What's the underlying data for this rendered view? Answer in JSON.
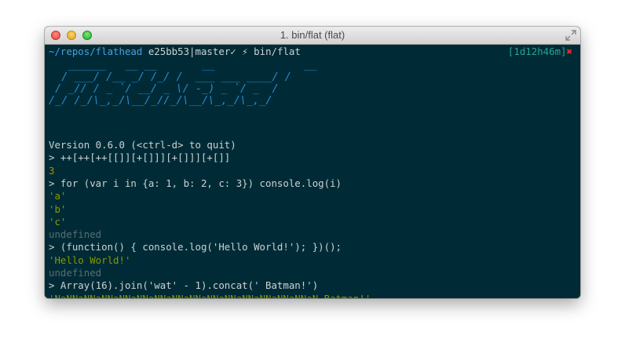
{
  "window": {
    "title": "1. bin/flat (flat)"
  },
  "prompt": {
    "path": "~/repos/flathead",
    "hash": "e25bb53",
    "separator": "|",
    "branch": "master",
    "check": "✓",
    "bolt": "⚡",
    "command": "bin/flat",
    "timer": "[1d12h46m]",
    "timer_mark": "✖"
  },
  "banner": {
    "ascii": "   ______   __ __       __              __\n  / ___/ /__ _/ /_/ /  ___ ___ ____/ /\n / _// / _ `/ __/ _ \\/ -_) _ `/ _  / \n/_/ /_/\\_,_/\\__/_//_/\\__/\\_,_/\\_,_/  "
  },
  "lines": [
    {
      "text": "Version 0.6.0 (<ctrl-d> to quit)",
      "kind": "plain"
    },
    {
      "text": "> ++[++[++[[]][+[]]][+[]]][+[]]",
      "kind": "plain"
    },
    {
      "text": "3",
      "kind": "yellow"
    },
    {
      "text": "> for (var i in {a: 1, b: 2, c: 3}) console.log(i)",
      "kind": "plain"
    },
    {
      "text": "'a'",
      "kind": "green"
    },
    {
      "text": "'b'",
      "kind": "green"
    },
    {
      "text": "'c'",
      "kind": "green"
    },
    {
      "text": "undefined",
      "kind": "grey"
    },
    {
      "text": "> (function() { console.log('Hello World!'); })();",
      "kind": "plain"
    },
    {
      "text": "'Hello World!'",
      "kind": "green"
    },
    {
      "text": "undefined",
      "kind": "grey"
    },
    {
      "text": "> Array(16).join('wat' - 1).concat(' Batman!')",
      "kind": "plain"
    },
    {
      "text": "'NaNNaNNaNNaNNaNNaNNaNNaNNaNNaNNaNNaNNaNNaNNaN Batman!'",
      "kind": "green"
    }
  ],
  "input_prompt": ">",
  "colors": {
    "terminal_bg": "#002b36",
    "path_blue": "#4a9fe0",
    "ascii_blue": "#268bd2",
    "timer_cyan": "#2aa198",
    "output_yellow": "#b58900",
    "output_green": "#859900",
    "output_grey": "#586e75",
    "error_red": "#dc322f"
  }
}
